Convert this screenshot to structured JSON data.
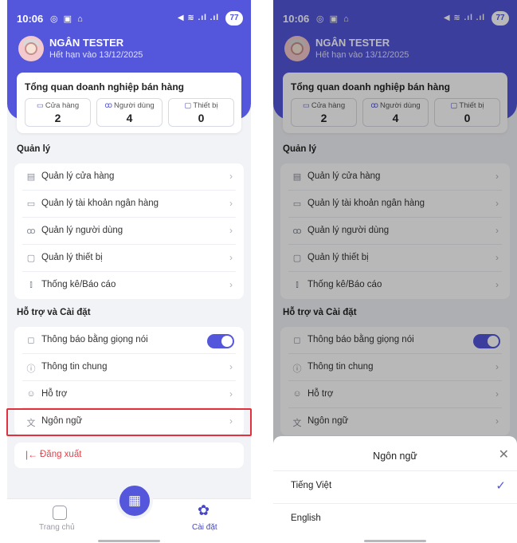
{
  "status": {
    "time": "10:06",
    "left_icons": "◎ ▣ ⌂",
    "right_icons": "◀ ≋ .ıl .ıl",
    "battery": "77"
  },
  "user": {
    "name": "NGÂN TESTER",
    "expiry": "Hết hạn vào 13/12/2025"
  },
  "overview": {
    "title": "Tổng quan doanh nghiệp bán hàng",
    "stats": [
      {
        "label": "Cửa hàng",
        "value": "2",
        "icon": "store-icon"
      },
      {
        "label": "Người dùng",
        "value": "4",
        "icon": "users-icon"
      },
      {
        "label": "Thiết bị",
        "value": "0",
        "icon": "device-icon"
      }
    ]
  },
  "management": {
    "title": "Quản lý",
    "items": [
      {
        "label": "Quản lý cửa hàng",
        "icon": "store-icon"
      },
      {
        "label": "Quản lý tài khoản ngân hàng",
        "icon": "bank-card-icon"
      },
      {
        "label": "Quản lý người dùng",
        "icon": "users-icon"
      },
      {
        "label": "Quản lý thiết bị",
        "icon": "device-icon"
      },
      {
        "label": "Thống kê/Báo cáo",
        "icon": "chart-icon"
      }
    ]
  },
  "support": {
    "title": "Hỗ trợ và Cài đặt",
    "items": [
      {
        "label": "Thông báo bằng giọng nói",
        "icon": "bell-icon",
        "toggle": true
      },
      {
        "label": "Thông tin chung",
        "icon": "info-icon"
      },
      {
        "label": "Hỗ trợ",
        "icon": "support-icon"
      },
      {
        "label": "Ngôn ngữ",
        "icon": "language-icon"
      }
    ]
  },
  "logout": {
    "label": "Đăng xuất",
    "icon": "logout-icon"
  },
  "nav": {
    "home_label": "Trang chủ",
    "settings_label": "Cài đặt",
    "qr_icon": "qr-code-icon"
  },
  "language_sheet": {
    "title": "Ngôn ngữ",
    "options": [
      {
        "label": "Tiếng Việt",
        "selected": true
      },
      {
        "label": "English",
        "selected": false
      }
    ]
  },
  "colors": {
    "primary": "#5457dc",
    "danger": "#e3414a",
    "highlight": "#e0313d"
  }
}
